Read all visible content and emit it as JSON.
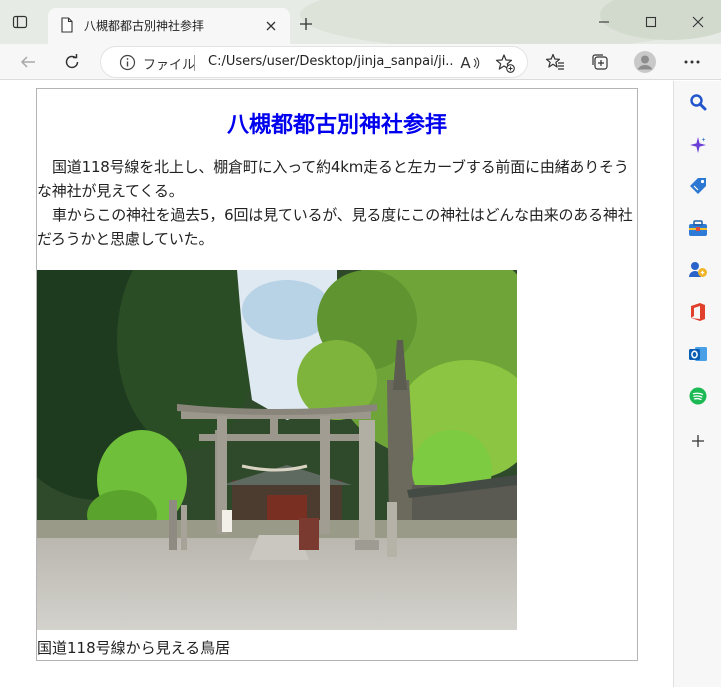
{
  "browser": {
    "tab_title": "八槻都都古別神社参拝",
    "address_scheme": "ファイル",
    "address_url": "C:/Users/user/Desktop/jinja_sanpai/ji...",
    "read_aloud_label": "A"
  },
  "page": {
    "heading": "八槻都都古別神社参拝",
    "paragraph1": "国道118号線を北上し、棚倉町に入って約4km走ると左カーブする前面に由緒ありそうな神社が見えてくる。",
    "paragraph2": "車からこの神社を過去5，6回は見ているが、見る度にこの神社はどんな由来のある神社だろうかと思慮していた。",
    "photo_caption": "国道118号線から見える鳥居"
  },
  "colors": {
    "heading": "#0000ee",
    "titlebar": "#e7ebe5",
    "toolbar": "#f7f7f7"
  },
  "sidebar_icons": [
    "search-icon",
    "copilot-icon",
    "shopping-tag-icon",
    "toolbox-icon",
    "games-icon",
    "office-icon",
    "outlook-icon",
    "spotify-icon",
    "add-icon"
  ]
}
